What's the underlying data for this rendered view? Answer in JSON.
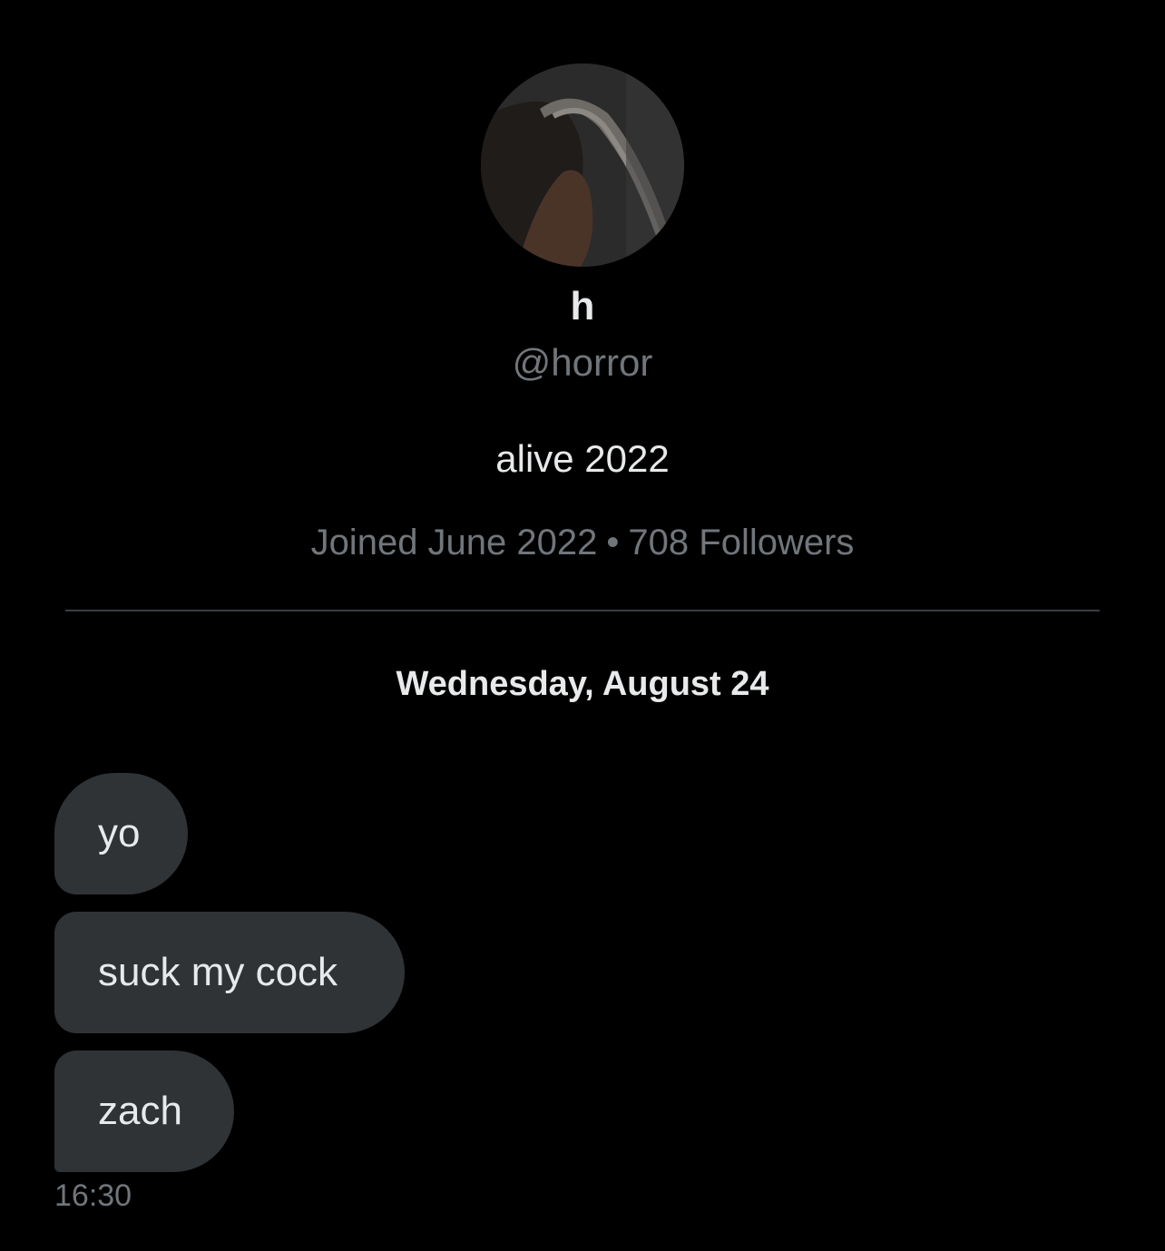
{
  "profile": {
    "display_name": "h",
    "handle": "@horror",
    "bio": "alive 2022",
    "joined": "Joined June 2022",
    "separator": "•",
    "followers": "708 Followers"
  },
  "conversation": {
    "date_separator": "Wednesday, August 24",
    "messages": [
      {
        "text": "yo"
      },
      {
        "text": "suck my cock"
      },
      {
        "text": "zach"
      }
    ],
    "timestamp": "16:30"
  },
  "colors": {
    "background": "#000000",
    "bubble": "#2f3336",
    "primary_text": "#e7e9ea",
    "secondary_text": "#71767b",
    "divider": "#3a3d41"
  }
}
